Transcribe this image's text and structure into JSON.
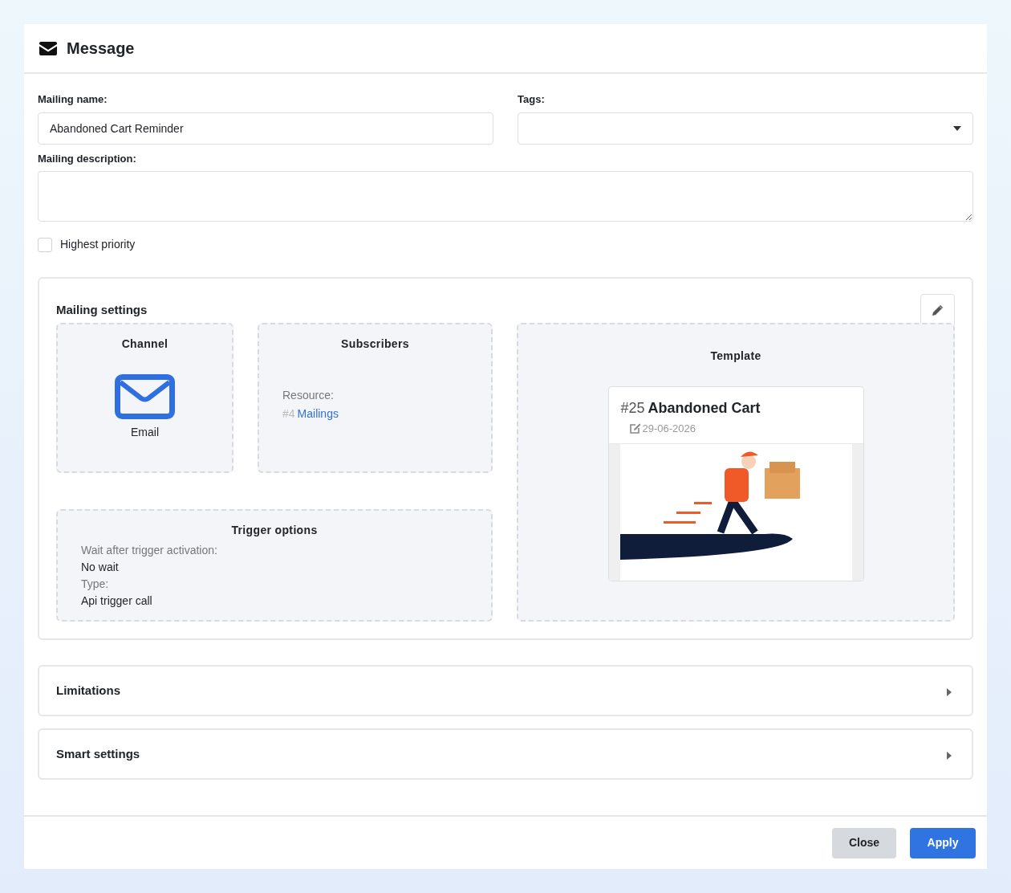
{
  "dialog": {
    "title": "Message"
  },
  "form": {
    "mailing_name": {
      "label": "Mailing name:",
      "value": "Abandoned Cart Reminder"
    },
    "tags": {
      "label": "Tags:"
    },
    "description": {
      "label": "Mailing description:"
    },
    "highest_priority": {
      "label": "Highest priority",
      "checked": false
    }
  },
  "mailing_settings": {
    "title": "Mailing settings",
    "channel": {
      "title": "Channel",
      "value": "Email"
    },
    "subscribers": {
      "title": "Subscribers",
      "label": "Resource:",
      "id": "#4",
      "link": "Mailings"
    },
    "trigger_options": {
      "title": "Trigger options",
      "fields": [
        {
          "label": "Wait after trigger activation:",
          "value": "No wait"
        },
        {
          "label": "Type:",
          "value": "Api trigger call"
        }
      ]
    },
    "template": {
      "title": "Template",
      "number": "#25",
      "name": "Abandoned Cart",
      "date": "29-06-2026"
    }
  },
  "sections": [
    {
      "title": "Limitations",
      "expanded": false
    },
    {
      "title": "Smart settings",
      "expanded": false
    }
  ],
  "buttons": [
    {
      "label": "Close",
      "kind": "secondary"
    },
    {
      "label": "Apply",
      "kind": "primary"
    }
  ]
}
